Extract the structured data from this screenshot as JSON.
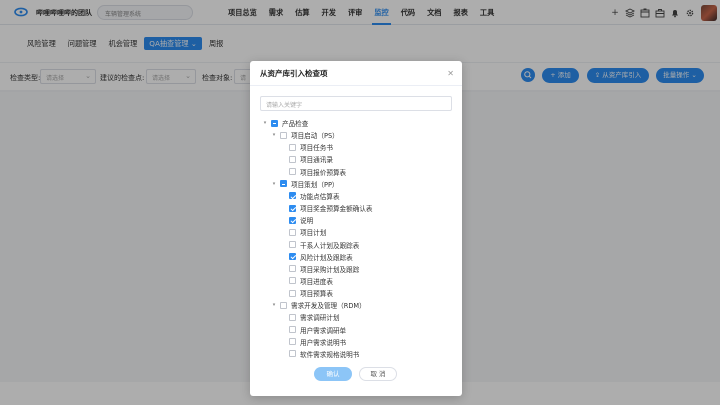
{
  "header": {
    "team_name": "哔哩哔哩哔的团队",
    "product_select": "车辆管理系统",
    "nav": [
      "项目总览",
      "需求",
      "估算",
      "开发",
      "评审",
      "监控",
      "代码",
      "文档",
      "报表",
      "工具"
    ],
    "active_nav": 5
  },
  "subnav": {
    "tabs": [
      "风险管理",
      "问题管理",
      "机会管理",
      "QA抽查管理",
      "周报"
    ],
    "active_tab": 3
  },
  "filter": {
    "type_label": "检查类型:",
    "type_placeholder": "请选择",
    "point_label": "建议的检查点:",
    "point_placeholder": "请选择",
    "object_label": "检查对象:",
    "object_placeholder": "请",
    "add_button": "+ 添加",
    "import_button": "从资产库引入",
    "batch_button": "批量操作"
  },
  "modal": {
    "title": "从资产库引入检查项",
    "search_placeholder": "请输入关键字",
    "confirm_button": "确认",
    "cancel_button": "取 消",
    "tree": [
      {
        "label": "产品检查",
        "level": 0,
        "state": "partial",
        "caret": true
      },
      {
        "label": "项目启动（PS）",
        "level": 1,
        "state": "unchecked",
        "caret": true
      },
      {
        "label": "项目任务书",
        "level": 2,
        "state": "unchecked"
      },
      {
        "label": "项目通讯录",
        "level": 2,
        "state": "unchecked"
      },
      {
        "label": "项目报价预算表",
        "level": 2,
        "state": "unchecked"
      },
      {
        "label": "项目策划（PP）",
        "level": 1,
        "state": "partial",
        "caret": true
      },
      {
        "label": "功能点估算表",
        "level": 2,
        "state": "checked"
      },
      {
        "label": "项目奖金预算金额确认表",
        "level": 2,
        "state": "checked"
      },
      {
        "label": "说明",
        "level": 2,
        "state": "checked"
      },
      {
        "label": "项目计划",
        "level": 2,
        "state": "unchecked"
      },
      {
        "label": "干系人计划及跟踪表",
        "level": 2,
        "state": "unchecked"
      },
      {
        "label": "风险计划及跟踪表",
        "level": 2,
        "state": "checked"
      },
      {
        "label": "项目采购计划及跟踪",
        "level": 2,
        "state": "unchecked"
      },
      {
        "label": "项目进度表",
        "level": 2,
        "state": "unchecked"
      },
      {
        "label": "项目预算表",
        "level": 2,
        "state": "unchecked"
      },
      {
        "label": "需求开发及管理（RDM）",
        "level": 1,
        "state": "unchecked",
        "caret": true
      },
      {
        "label": "需求调研计划",
        "level": 2,
        "state": "unchecked"
      },
      {
        "label": "用户需求调研单",
        "level": 2,
        "state": "unchecked"
      },
      {
        "label": "用户需求说明书",
        "level": 2,
        "state": "unchecked"
      },
      {
        "label": "软件需求规格说明书",
        "level": 2,
        "state": "unchecked"
      }
    ]
  }
}
